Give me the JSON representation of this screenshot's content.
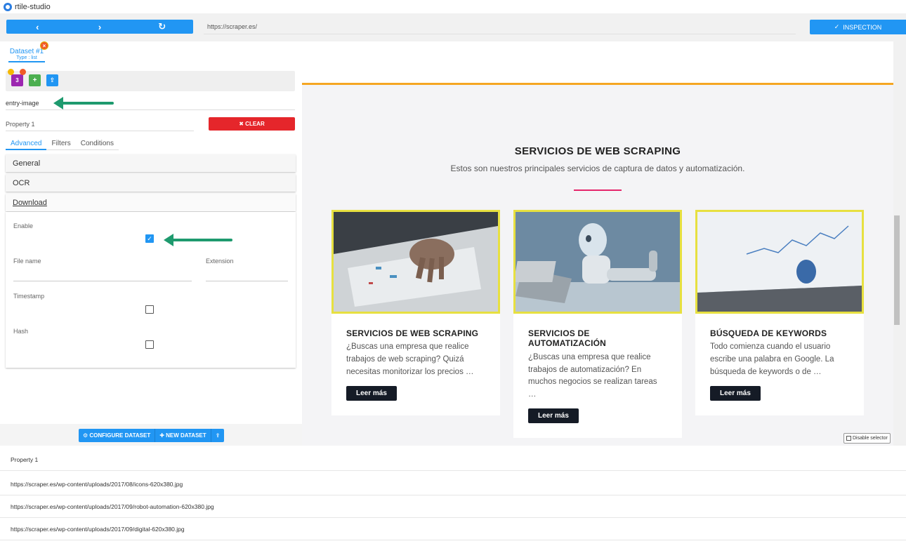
{
  "app": {
    "title": "rtile-studio"
  },
  "toolbar": {
    "back": "‹",
    "forward": "›",
    "reload": "↻",
    "url": "https://scraper.es/",
    "inspection_label": "INSPECTION",
    "inspection_icon": "✓"
  },
  "dataset": {
    "tab_label": "Dataset #1",
    "tab_type": "Type : list",
    "close": "×",
    "count": "3",
    "add": "+",
    "upload": "⇪"
  },
  "selector": {
    "value": "entry-image"
  },
  "property": {
    "name": "Property 1",
    "clear_label": "✖ CLEAR"
  },
  "tabs": [
    "Advanced",
    "Filters",
    "Conditions"
  ],
  "accordions": {
    "general": "General",
    "ocr": "OCR",
    "download": "Download"
  },
  "download": {
    "enable_label": "Enable",
    "enable_checked": true,
    "file_name_label": "File name",
    "extension_label": "Extension",
    "timestamp_label": "Timestamp",
    "hash_label": "Hash"
  },
  "bottom_actions": {
    "configure": "⚙ CONFIGURE DATASET",
    "new": "✚ NEW DATASET",
    "export": "⇪"
  },
  "web": {
    "title": "SERVICIOS DE WEB SCRAPING",
    "subtitle": "Estos son nuestros principales servicios de captura de datos y automatización.",
    "cards": [
      {
        "title": "SERVICIOS DE WEB SCRAPING",
        "text": "¿Buscas una empresa que realice trabajos de web scraping? Quizá necesitas monitorizar los precios …",
        "button": "Leer más"
      },
      {
        "title": "SERVICIOS DE AUTOMATIZACIÓN",
        "text": "¿Buscas una empresa que realice trabajos de automatización? En muchos negocios se realizan tareas …",
        "button": "Leer más"
      },
      {
        "title": "BÚSQUEDA DE KEYWORDS",
        "text": "Todo comienza cuando el usuario escribe una palabra en Google. La búsqueda de keywords o de …",
        "button": "Leer más"
      }
    ],
    "disable_selector": "Disable selector"
  },
  "results": {
    "header": "Property 1",
    "rows": [
      "https://scraper.es/wp-content/uploads/2017/08/icons-620x380.jpg",
      "https://scraper.es/wp-content/uploads/2017/09/robot-automation-620x380.jpg",
      "https://scraper.es/wp-content/uploads/2017/09/digital-620x380.jpg"
    ]
  },
  "colors": {
    "accent": "#2196f3",
    "danger": "#e5262b",
    "success": "#4caf50",
    "arrow": "#1e9a6e",
    "highlight": "#e7e040"
  }
}
